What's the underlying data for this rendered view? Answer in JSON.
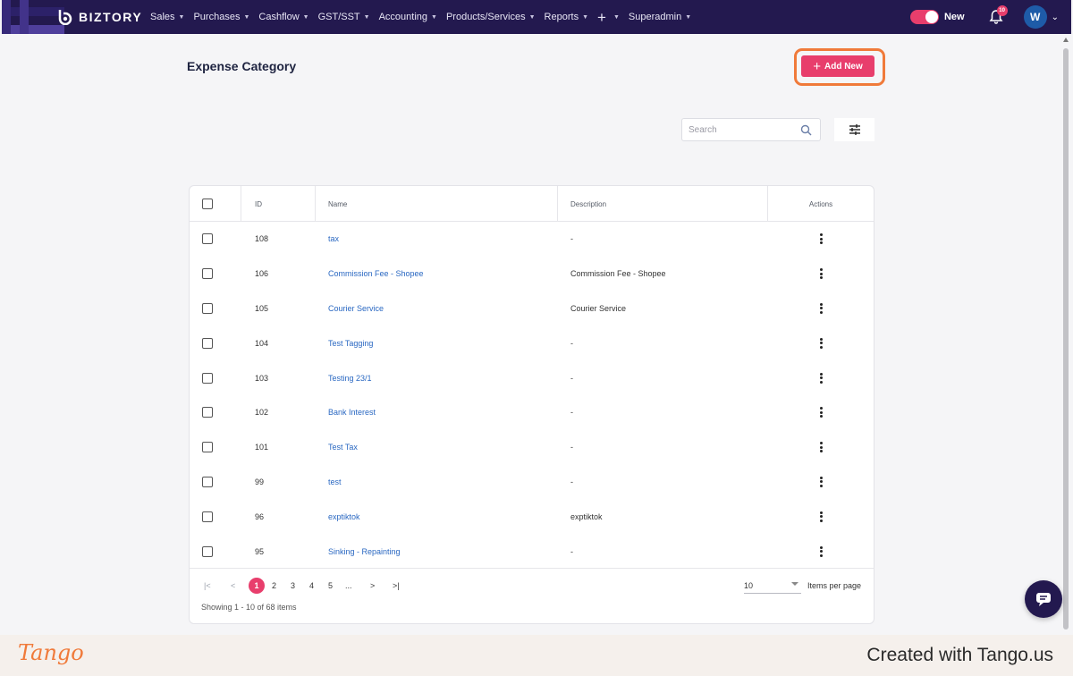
{
  "app": {
    "brand": "BIZTORY"
  },
  "nav": {
    "items": [
      {
        "label": "Sales"
      },
      {
        "label": "Purchases"
      },
      {
        "label": "Cashflow"
      },
      {
        "label": "GST/SST"
      },
      {
        "label": "Accounting"
      },
      {
        "label": "Products/Services"
      },
      {
        "label": "Reports"
      }
    ],
    "plus": "+",
    "superadmin": "Superadmin",
    "toggle_label": "New",
    "notification_count": "10",
    "avatar_initial": "W"
  },
  "page": {
    "title": "Expense Category",
    "add_button_label": "Add New"
  },
  "search": {
    "placeholder": "Search"
  },
  "table": {
    "columns": {
      "id": "ID",
      "name": "Name",
      "description": "Description",
      "actions": "Actions"
    },
    "rows": [
      {
        "id": "108",
        "name": "tax",
        "description": "-"
      },
      {
        "id": "106",
        "name": "Commission Fee - Shopee",
        "description": "Commission Fee - Shopee"
      },
      {
        "id": "105",
        "name": "Courier Service",
        "description": "Courier Service"
      },
      {
        "id": "104",
        "name": "Test Tagging",
        "description": "-"
      },
      {
        "id": "103",
        "name": "Testing 23/1",
        "description": "-"
      },
      {
        "id": "102",
        "name": "Bank Interest",
        "description": "-"
      },
      {
        "id": "101",
        "name": "Test Tax",
        "description": "-"
      },
      {
        "id": "99",
        "name": "test",
        "description": "-"
      },
      {
        "id": "96",
        "name": "exptiktok",
        "description": "exptiktok"
      },
      {
        "id": "95",
        "name": "Sinking - Repainting",
        "description": "-"
      }
    ]
  },
  "pagination": {
    "first": "|<",
    "prev": "<",
    "pages": [
      "1",
      "2",
      "3",
      "4",
      "5",
      "..."
    ],
    "current_page": "1",
    "next": ">",
    "last": ">|",
    "items_per_page_value": "10",
    "items_per_page_label": "Items per page",
    "showing": "Showing 1 - 10 of 68 items"
  },
  "footer": {
    "logo_text": "Tango",
    "credit": "Created with Tango.us"
  },
  "colors": {
    "nav_bg": "#23194f",
    "accent_pink": "#e83e6c",
    "highlight_orange": "#f07a3a",
    "link_blue": "#2a68c2"
  },
  "icons": [
    "search-icon",
    "filter-sliders-icon",
    "bell-icon",
    "chevron-down-icon",
    "kebab-menu-icon",
    "chat-icon",
    "plus-icon"
  ]
}
